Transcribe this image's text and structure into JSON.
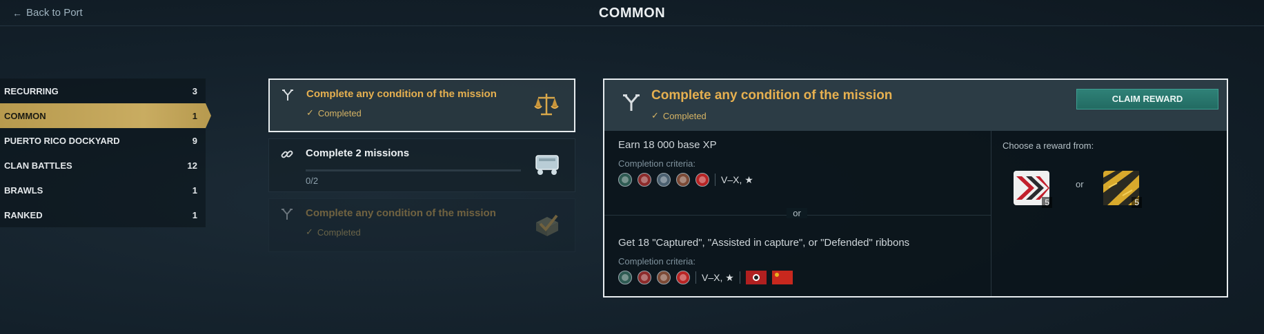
{
  "header": {
    "back_label": "Back to Port",
    "title": "COMMON"
  },
  "sidebar": {
    "items": [
      {
        "label": "RECURRING",
        "count": "3"
      },
      {
        "label": "COMMON",
        "count": "1"
      },
      {
        "label": "PUERTO RICO DOCKYARD",
        "count": "9"
      },
      {
        "label": "CLAN BATTLES",
        "count": "12"
      },
      {
        "label": "BRAWLS",
        "count": "1"
      },
      {
        "label": "RANKED",
        "count": "1"
      }
    ]
  },
  "missions": [
    {
      "title": "Complete any condition of the mission",
      "status": "Completed",
      "icon": "branch-icon",
      "picture": "scales-icon"
    },
    {
      "title": "Complete 2 missions",
      "progress_text": "0/2",
      "progress": 0,
      "icon": "link-icon",
      "picture": "container-icon"
    },
    {
      "title": "Complete any condition of the mission",
      "status": "Completed",
      "icon": "branch-icon",
      "picture": "check-crate-icon"
    }
  ],
  "detail": {
    "title": "Complete any condition of the mission",
    "status": "Completed",
    "claim_label": "CLAIM REWARD",
    "conditions": [
      {
        "title": "Earn 18 000 base XP",
        "criteria_label": "Completion criteria:",
        "tiers": "V–X, ★"
      },
      {
        "title": "Get 18 \"Captured\", \"Assisted in capture\", or \"Defended\" ribbons",
        "criteria_label": "Completion criteria:",
        "tiers": "V–X, ★"
      }
    ],
    "or_label": "or",
    "rewards": {
      "choose_label": "Choose a reward from:",
      "or_label": "or",
      "items": [
        {
          "name": "red-chevron-camo-icon",
          "count": "5"
        },
        {
          "name": "gold-camo-icon",
          "count": "5"
        }
      ]
    }
  },
  "colors": {
    "accent_gold": "#e6b050",
    "active_tab": "#c9ac61",
    "claim_button": "#2f8177"
  }
}
